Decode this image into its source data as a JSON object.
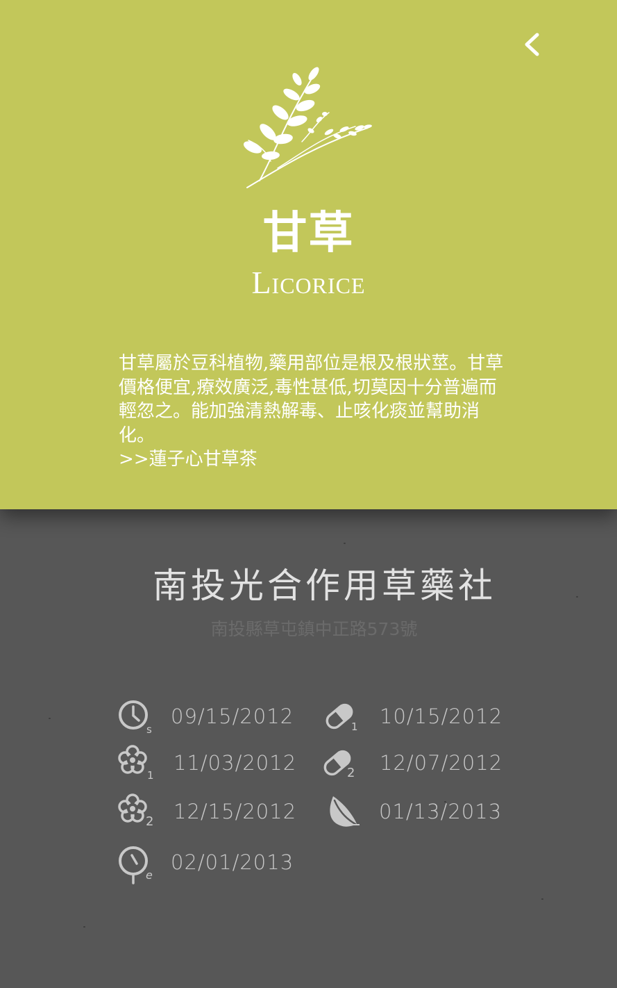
{
  "nav": {
    "back_icon": "chevron-left-icon"
  },
  "herb": {
    "illustration_icon": "herb-branch-icon",
    "name_cn": "甘草",
    "name_en": "Licorice",
    "description": "甘草屬於豆科植物,藥用部位是根及根狀莖。甘草價格便宜,療效廣泛,毒性甚低,切莫因十分普遍而輕忽之。能加強清熱解毒、止咳化痰並幫助消化。",
    "recipe_link": ">>蓮子心甘草茶"
  },
  "shop": {
    "name": "南投光合作用草藥社",
    "address": "南投縣草屯鎮中正路573號"
  },
  "timeline": [
    {
      "icon": "clock-start-icon",
      "sub": "s",
      "date": "09/15/2012"
    },
    {
      "icon": "pill-1-icon",
      "sub": "1",
      "date": "10/15/2012"
    },
    {
      "icon": "flower-1-icon",
      "sub": "1",
      "date": "11/03/2012"
    },
    {
      "icon": "pill-2-icon",
      "sub": "2",
      "date": "12/07/2012"
    },
    {
      "icon": "flower-2-icon",
      "sub": "2",
      "date": "12/15/2012"
    },
    {
      "icon": "leaf-icon",
      "sub": "",
      "date": "01/13/2013"
    },
    {
      "icon": "clock-end-icon",
      "sub": "e",
      "date": "02/01/2013"
    }
  ],
  "colors": {
    "accent": "#c2c75a",
    "background": "#575757",
    "text_light": "#ffffff",
    "date_text": "#c8c8c8",
    "address_text": "#6b6b6b"
  }
}
